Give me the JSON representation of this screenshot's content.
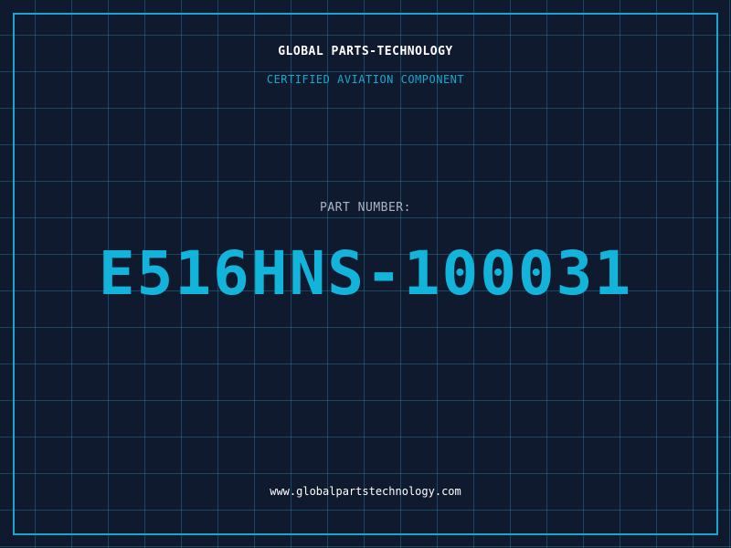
{
  "header": {
    "company_name": "GLOBAL PARTS-TECHNOLOGY",
    "subtitle": "CERTIFIED AVIATION COMPONENT"
  },
  "part": {
    "label": "PART NUMBER:",
    "number": "E516HNS-100031"
  },
  "footer": {
    "website": "www.globalpartstechnology.com"
  },
  "colors": {
    "background": "#101a2e",
    "grid": "#206e8c",
    "accent": "#12b4dc",
    "frame": "#1aa7cf",
    "label": "#aab4c4",
    "text": "#ffffff"
  }
}
